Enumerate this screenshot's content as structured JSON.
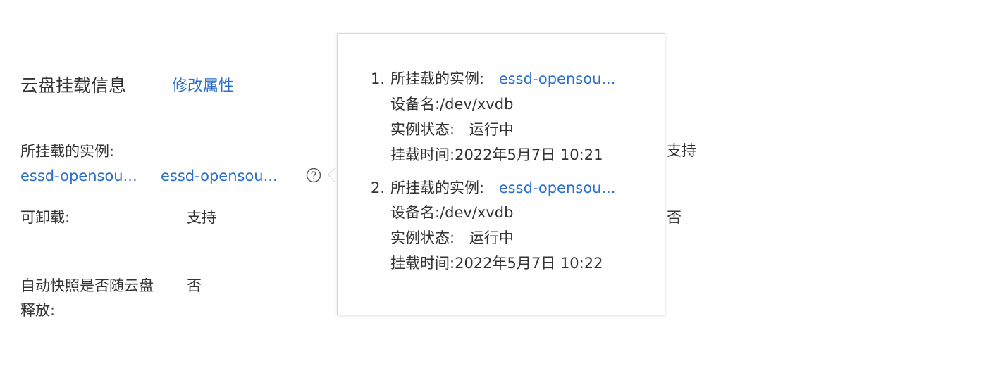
{
  "section": {
    "title": "云盘挂载信息",
    "edit_link": "修改属性"
  },
  "fields": {
    "attached_instance_label": "所挂载的实例:",
    "instance_links": [
      "essd-opensou...",
      "essd-opensou..."
    ],
    "detachable_label": "可卸载:",
    "detachable_value": "支持",
    "snapshot_release_label_line1": "自动快照是否随云盘",
    "snapshot_release_label_line2": "释放:",
    "snapshot_release_value": "否"
  },
  "right_column": {
    "value_1": "支持",
    "value_2": "否"
  },
  "popover": {
    "entries": [
      {
        "index": "1.",
        "instance_label": "所挂载的实例:",
        "instance_value": "essd-opensou...",
        "device_label": "设备名:",
        "device_value": "/dev/xvdb",
        "status_label": "实例状态:",
        "status_value": "运行中",
        "time_label": "挂载时间:",
        "time_value": "2022年5月7日 10:21"
      },
      {
        "index": "2.",
        "instance_label": "所挂载的实例:",
        "instance_value": "essd-opensou...",
        "device_label": "设备名:",
        "device_value": "/dev/xvdb",
        "status_label": "实例状态:",
        "status_value": "运行中",
        "time_label": "挂载时间:",
        "time_value": "2022年5月7日 10:22"
      }
    ]
  },
  "icons": {
    "help": "question-circle-icon"
  },
  "colors": {
    "link": "#2a6fcd",
    "text": "#333333",
    "border": "#d9d9d9"
  }
}
